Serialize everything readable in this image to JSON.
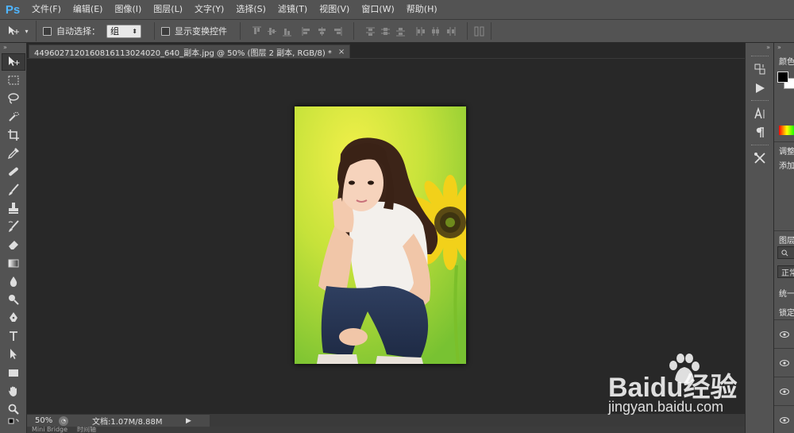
{
  "app": {
    "logo": "Ps"
  },
  "menu": {
    "items": [
      "文件(F)",
      "编辑(E)",
      "图像(I)",
      "图层(L)",
      "文字(Y)",
      "选择(S)",
      "滤镜(T)",
      "视图(V)",
      "窗口(W)",
      "帮助(H)"
    ]
  },
  "options": {
    "tool_icon": "move-tool-icon",
    "auto_select_label": "自动选择：",
    "auto_select_value": "组",
    "show_transform_label": "显示变换控件"
  },
  "document": {
    "tab_title": "44960271201608161130240​20_640_副本.jpg @ 50% (图层 2 副本, RGB/8) *",
    "close_glyph": "×"
  },
  "status": {
    "zoom": "50%",
    "doc_info": "文档:1.07M/8.88M",
    "arrow": "▶"
  },
  "bottom_tabs": [
    "Mini Bridge",
    "时间轴"
  ],
  "panels": {
    "color_title": "颜色",
    "adjust_title": "调整",
    "adjust_add": "添加",
    "layers_title": "图层",
    "blend_mode": "正常",
    "unify": "统一",
    "lock": "锁定"
  },
  "collapse_glyph": "»",
  "watermark": {
    "brand": "Baidu经验",
    "url": "jingyan.baidu.com"
  },
  "colors": {
    "menubar": "#535353",
    "workspace": "#282828",
    "ps_blue": "#4fb5ff"
  }
}
